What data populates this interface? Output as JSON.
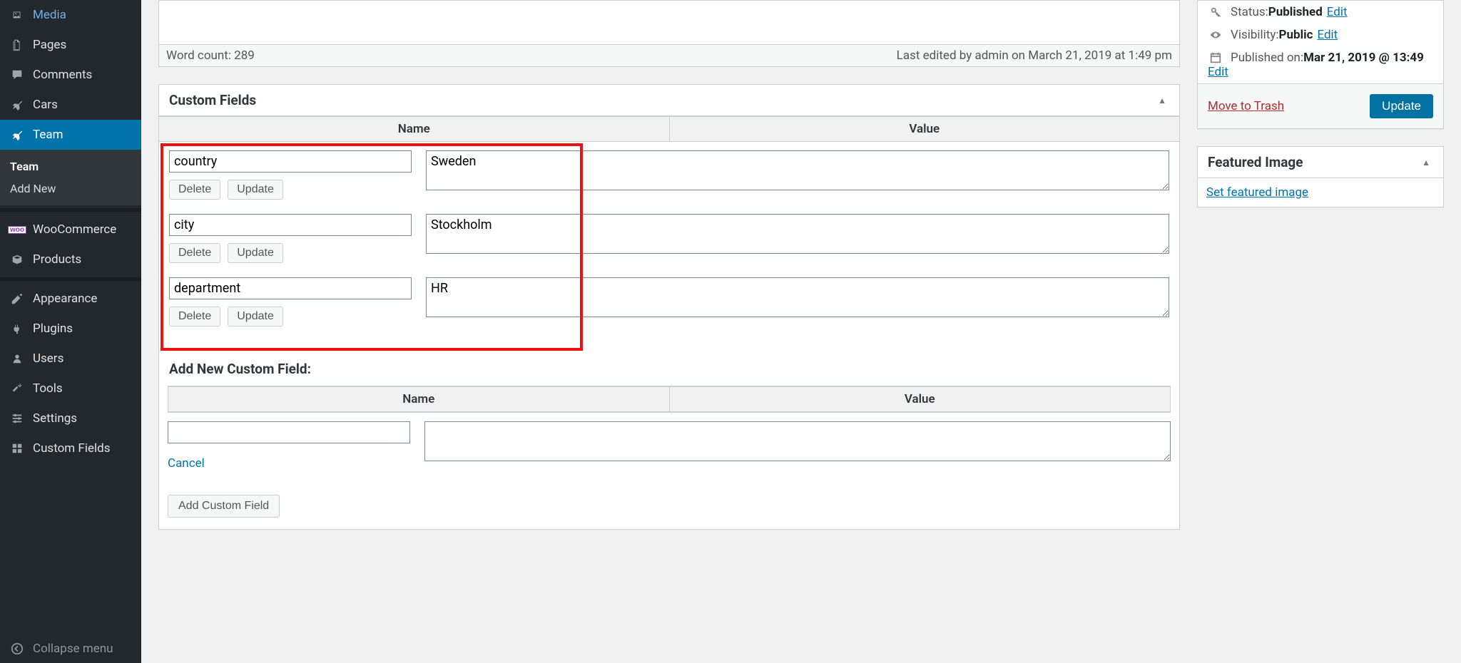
{
  "sidebar": {
    "items": [
      {
        "label": "Media"
      },
      {
        "label": "Pages"
      },
      {
        "label": "Comments"
      },
      {
        "label": "Cars"
      },
      {
        "label": "Team"
      },
      {
        "label": "WooCommerce"
      },
      {
        "label": "Products"
      },
      {
        "label": "Appearance"
      },
      {
        "label": "Plugins"
      },
      {
        "label": "Users"
      },
      {
        "label": "Tools"
      },
      {
        "label": "Settings"
      },
      {
        "label": "Custom Fields"
      }
    ],
    "sub": {
      "team": "Team",
      "add_new": "Add New"
    },
    "collapse": "Collapse menu"
  },
  "editor": {
    "word_count": "Word count: 289",
    "last_edited": "Last edited by admin on March 21, 2019 at 1:49 pm"
  },
  "custom_fields": {
    "title": "Custom Fields",
    "col_name": "Name",
    "col_value": "Value",
    "rows": [
      {
        "name": "country",
        "value": "Sweden"
      },
      {
        "name": "city",
        "value": "Stockholm"
      },
      {
        "name": "department",
        "value": "HR"
      }
    ],
    "delete": "Delete",
    "update": "Update",
    "add_header": "Add New Custom Field:",
    "add_col_name": "Name",
    "add_col_value": "Value",
    "new_name": "",
    "new_value": "",
    "cancel": "Cancel",
    "add_btn": "Add Custom Field"
  },
  "publish": {
    "status_label": "Status: ",
    "status_value": "Published",
    "visibility_label": "Visibility: ",
    "visibility_value": "Public",
    "published_label": "Published on: ",
    "published_value": "Mar 21, 2019 @ 13:49",
    "edit": "Edit",
    "move_to_trash": "Move to Trash",
    "update": "Update"
  },
  "featured": {
    "title": "Featured Image",
    "set_link": "Set featured image"
  }
}
